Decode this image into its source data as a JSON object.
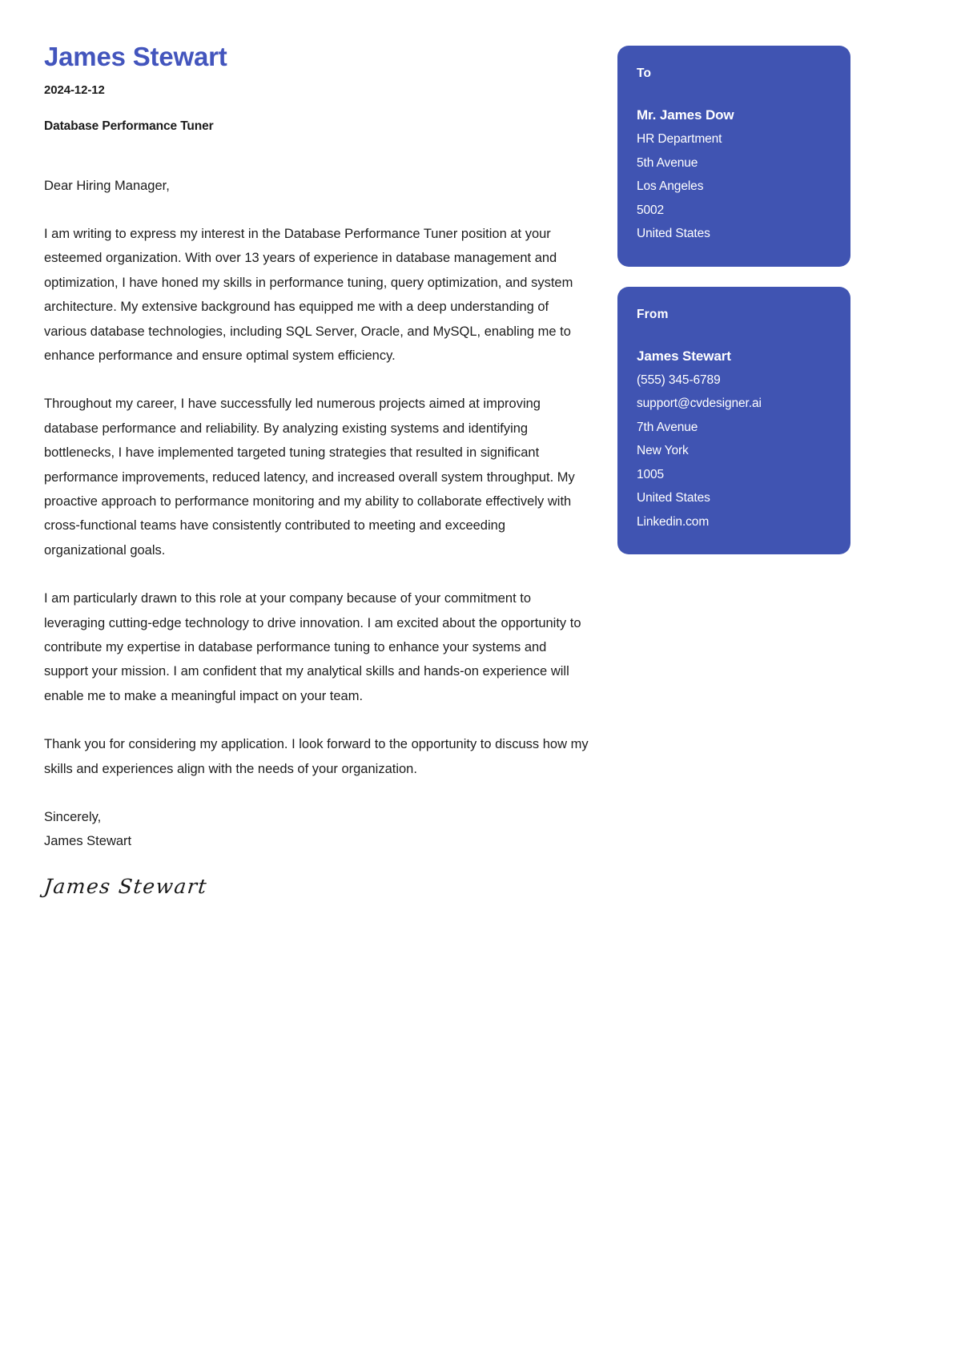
{
  "document": {
    "type": "cover-letter",
    "accent_color": "#4054b2",
    "name_color": "#4355bd",
    "background_color": "#ffffff"
  },
  "header": {
    "candidate_name": "James Stewart",
    "date": "2024-12-12",
    "job_title": "Database Performance Tuner"
  },
  "letter": {
    "salutation": "Dear Hiring Manager,",
    "paragraphs": [
      "I am writing to express my interest in the Database Performance Tuner position at your esteemed organization. With over 13 years of experience in database management and optimization, I have honed my skills in performance tuning, query optimization, and system architecture. My extensive background has equipped me with a deep understanding of various database technologies, including SQL Server, Oracle, and MySQL, enabling me to enhance performance and ensure optimal system efficiency.",
      "Throughout my career, I have successfully led numerous projects aimed at improving database performance and reliability. By analyzing existing systems and identifying bottlenecks, I have implemented targeted tuning strategies that resulted in significant performance improvements, reduced latency, and increased overall system throughput. My proactive approach to performance monitoring and my ability to collaborate effectively with cross-functional teams have consistently contributed to meeting and exceeding organizational goals.",
      "I am particularly drawn to this role at your company because of your commitment to leveraging cutting-edge technology to drive innovation. I am excited about the opportunity to contribute my expertise in database performance tuning to enhance your systems and support your mission. I am confident that my analytical skills and hands-on experience will enable me to make a meaningful impact on your team.",
      "Thank you for considering my application. I look forward to the opportunity to discuss how my skills and experiences align with the needs of your organization."
    ],
    "closing": "Sincerely,",
    "closing_name": "James Stewart",
    "signature": "James Stewart"
  },
  "recipient_card": {
    "heading": "To",
    "name": "Mr. James Dow",
    "lines": [
      "HR Department",
      "5th Avenue",
      "Los Angeles",
      "5002",
      "United States"
    ]
  },
  "sender_card": {
    "heading": "From",
    "name": "James Stewart",
    "lines": [
      "(555) 345-6789",
      "support@cvdesigner.ai",
      "7th Avenue",
      "New York",
      "1005",
      "United States",
      "Linkedin.com"
    ]
  }
}
